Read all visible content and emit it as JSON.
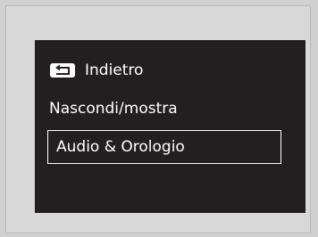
{
  "menu": {
    "items": [
      {
        "label": "Indietro",
        "icon": "back-icon"
      },
      {
        "label": "Nascondi/mostra"
      },
      {
        "label": "Audio & Orologio",
        "selected": true
      }
    ]
  },
  "colors": {
    "panel_background": "#231f20",
    "text": "#ffffff",
    "page_background": "#d0d0d0"
  }
}
